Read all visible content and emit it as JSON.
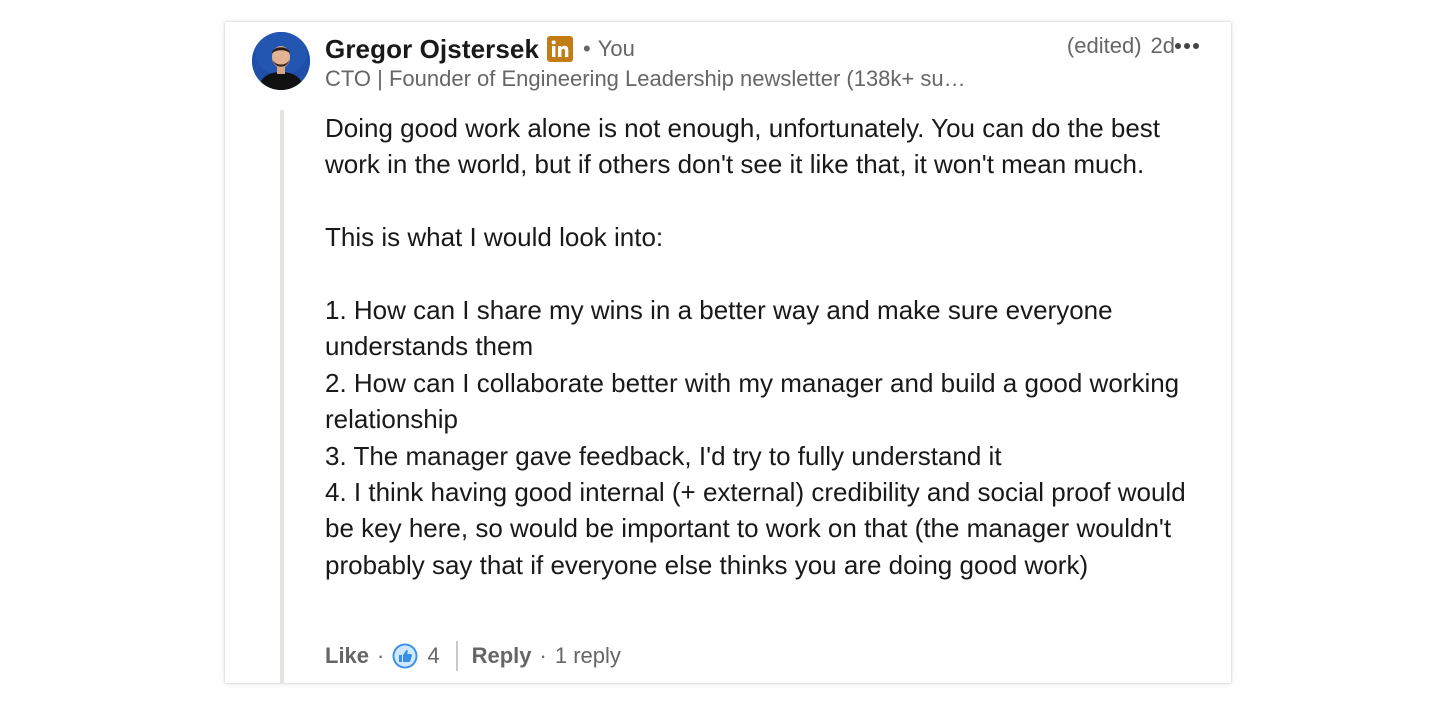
{
  "author": {
    "name": "Gregor Ojstersek",
    "relation": "You",
    "headline": "CTO | Founder of Engineering Leadership newsletter (138k+ su…"
  },
  "meta": {
    "edited": "(edited)",
    "age": "2d"
  },
  "comment": {
    "paragraphs": [
      "Doing good work alone is not enough, unfortunately. You can do the best work in the world, but if others don't see it like that, it won't mean much.",
      "This is what I would look into:"
    ],
    "list": [
      "1. How can I share my wins in a better way and make sure everyone understands them",
      "2. How can I collaborate better with my manager and build a good working relationship",
      "3. The manager gave feedback, I'd try to fully understand it",
      "4. I think having good internal (+ external) credibility and social proof would be key here, so would be important to work on that (the manager wouldn't probably say that if everyone else thinks you are doing good work)"
    ]
  },
  "actions": {
    "like_label": "Like",
    "like_count": "4",
    "reply_label": "Reply",
    "reply_count": "1 reply"
  },
  "colors": {
    "text": "#191919",
    "muted": "#666666",
    "badge": "#c37d16",
    "like_blue": "#378fe9"
  },
  "icons": {
    "badge": "linkedin-icon",
    "more": "more-horizontal-icon",
    "reaction": "like-reaction-icon"
  }
}
